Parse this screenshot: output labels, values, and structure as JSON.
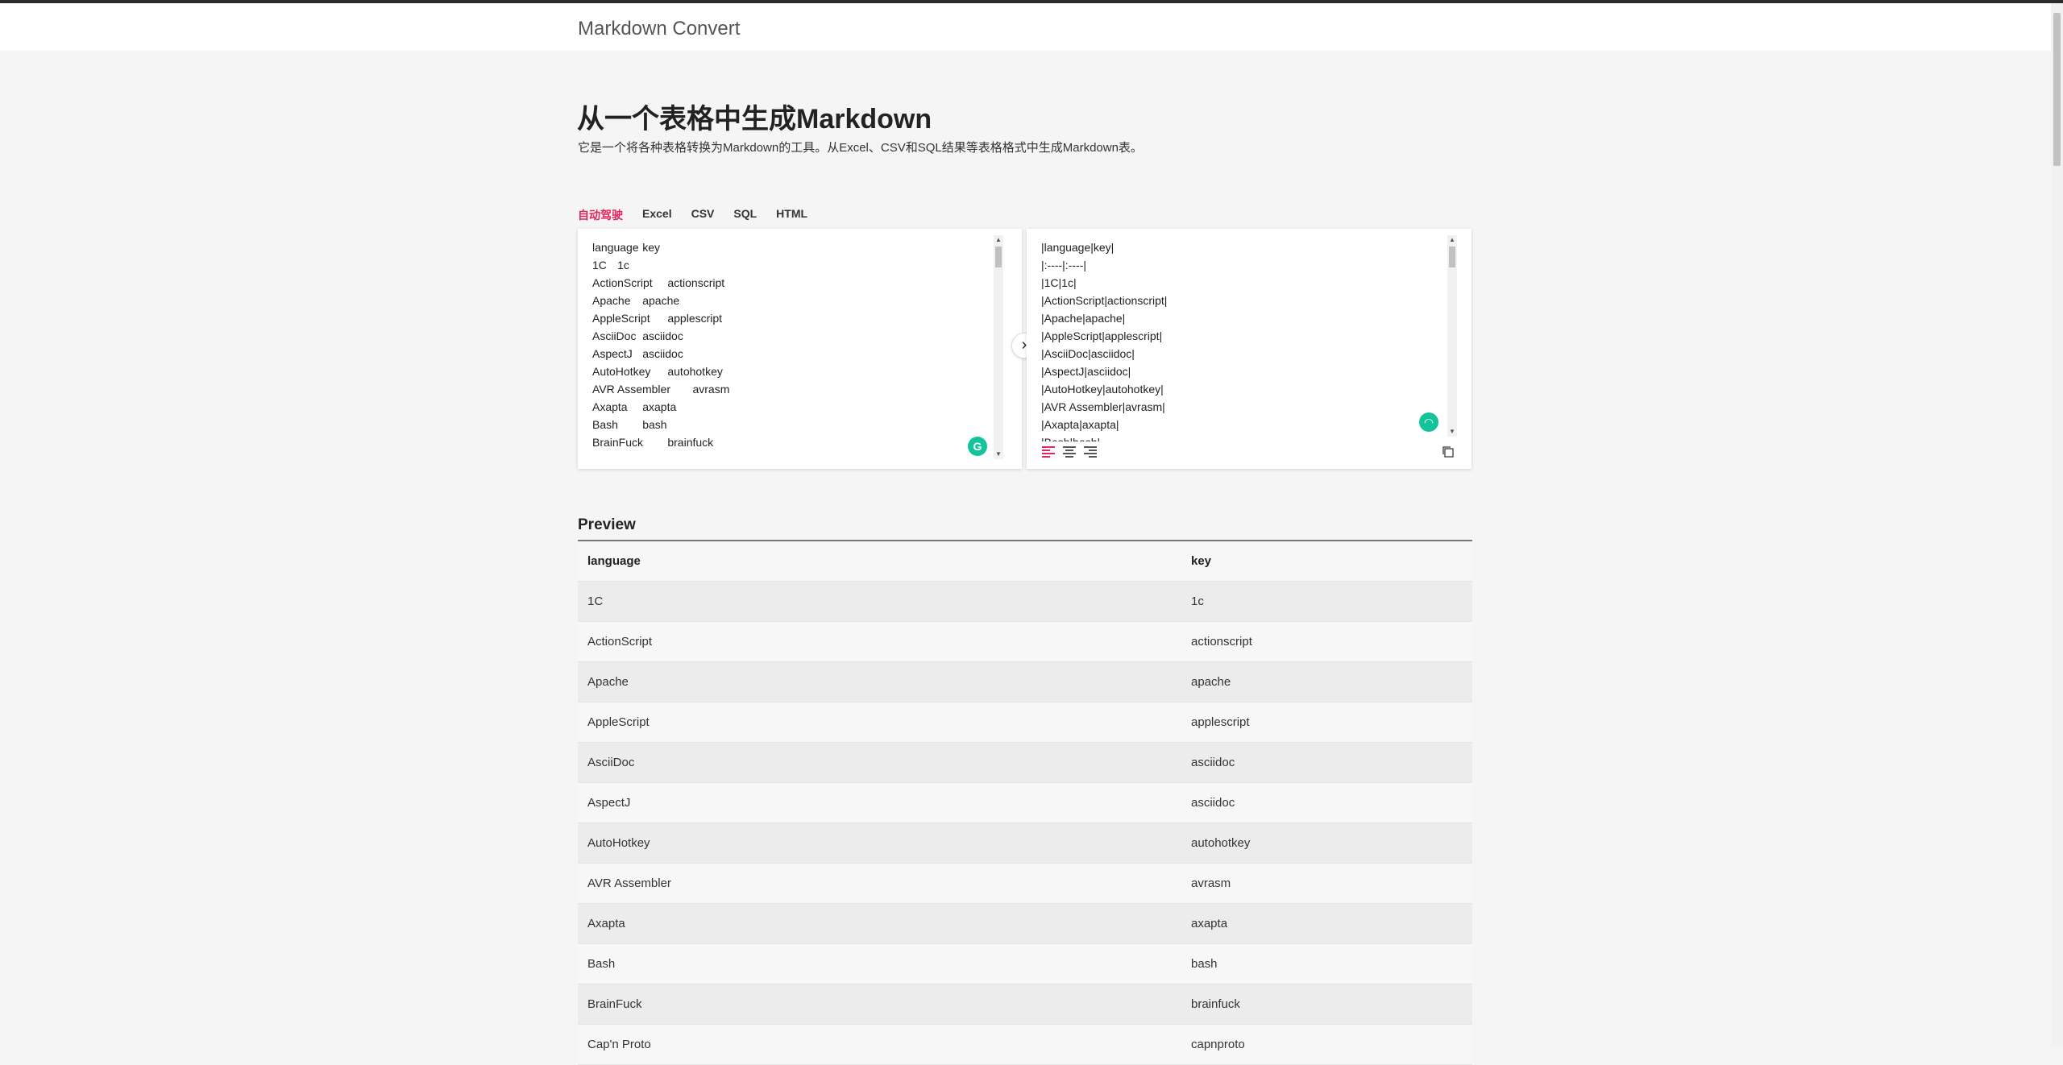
{
  "app": {
    "brand": "Markdown Convert"
  },
  "header": {
    "title": "从一个表格中生成Markdown",
    "description": "它是一个将各种表格转换为Markdown的工具。从Excel、CSV和SQL结果等表格格式中生成Markdown表。"
  },
  "tabs": [
    {
      "label": "自动驾驶",
      "active": true
    },
    {
      "label": "Excel",
      "active": false
    },
    {
      "label": "CSV",
      "active": false
    },
    {
      "label": "SQL",
      "active": false
    },
    {
      "label": "HTML",
      "active": false
    }
  ],
  "input": {
    "value": "language\tkey\n1C\t1c\nActionScript\tactionscript\nApache\tapache\nAppleScript\tapplescript\nAsciiDoc\tasciidoc\nAspectJ\tasciidoc\nAutoHotkey\tautohotkey\nAVR Assembler\tavrasm\nAxapta\taxapta\nBash\tbash\nBrainFuck\tbrainfuck\nCap'n Proto\tcapnproto"
  },
  "output": {
    "value": "|language|key|\n|:----|:----|\n|1C|1c|\n|ActionScript|actionscript|\n|Apache|apache|\n|AppleScript|applescript|\n|AsciiDoc|asciidoc|\n|AspectJ|asciidoc|\n|AutoHotkey|autohotkey|\n|AVR Assembler|avrasm|\n|Axapta|axapta|\n|Bash|bash|"
  },
  "icons": {
    "convert": "chevron-right-icon",
    "align_left": "align-left-icon",
    "align_center": "align-center-icon",
    "align_right": "align-right-icon",
    "copy": "copy-icon",
    "grammarly": "grammarly-icon"
  },
  "colors": {
    "active_tab": "#e0245e",
    "grammarly": "#15c39a"
  },
  "preview": {
    "title": "Preview",
    "columns": [
      "language",
      "key"
    ],
    "rows": [
      [
        "1C",
        "1c"
      ],
      [
        "ActionScript",
        "actionscript"
      ],
      [
        "Apache",
        "apache"
      ],
      [
        "AppleScript",
        "applescript"
      ],
      [
        "AsciiDoc",
        "asciidoc"
      ],
      [
        "AspectJ",
        "asciidoc"
      ],
      [
        "AutoHotkey",
        "autohotkey"
      ],
      [
        "AVR Assembler",
        "avrasm"
      ],
      [
        "Axapta",
        "axapta"
      ],
      [
        "Bash",
        "bash"
      ],
      [
        "BrainFuck",
        "brainfuck"
      ],
      [
        "Cap'n Proto",
        "capnproto"
      ]
    ]
  }
}
